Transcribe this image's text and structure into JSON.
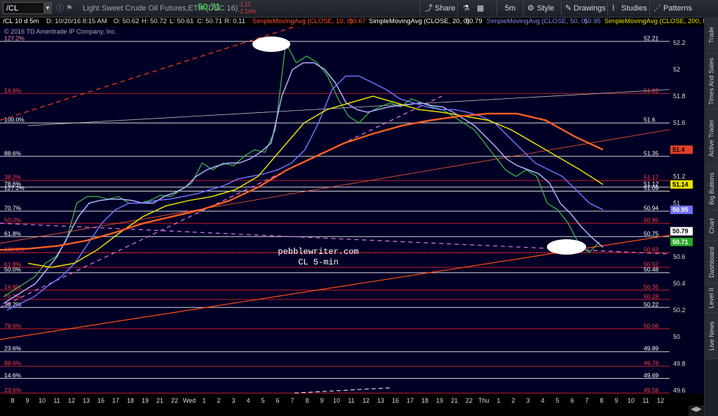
{
  "toolbar": {
    "symbol": "/CL",
    "description": "Light Sweet Crude Oil Futures,ETH (DEC 16)",
    "last_price": "50.71",
    "change": "-1.11",
    "change_pct": "-2.14%",
    "share_label": "Share",
    "timeframe": "5m",
    "style_label": "Style",
    "drawings_label": "Drawings",
    "studies_label": "Studies",
    "patterns_label": "Patterns",
    "icons": [
      "info-icon",
      "flag-icon",
      "lock-icon",
      "share-icon",
      "flask-icon",
      "grid-icon",
      "style-icon",
      "drawings-icon",
      "studies-icon",
      "patterns-icon"
    ]
  },
  "infobar": {
    "symbol": "/CL 10 d 5m",
    "date": "D: 10/20/16 8:15 AM",
    "open": "O: 50.62",
    "high": "H: 50.72",
    "low": "L: 50.61",
    "close": "C: 50.71",
    "range": "R: 0.11",
    "sma10": "SimpleMovingAvg (CLOSE, 10, 0)",
    "sma10_val": "50.67",
    "sma20": "SimpleMovingAvg (CLOSE, 20, 0)",
    "sma20_val": "50.79",
    "sma50": "SimpleMovingAvg (CLOSE, 50, 0)",
    "sma50_val": "50.95",
    "sma200": "SimpleMovingAvg (CLOSE, 200, 0)",
    "copyright": "© 2016 TD Ameritrade IP Company, Inc."
  },
  "watermark": {
    "line1": "pebblewriter.com",
    "line2": "CL 5-min"
  },
  "fib_levels": [
    {
      "pct": "127.2%",
      "price": "52.21",
      "pct_color": "#ff9a9a",
      "price_color": "#ffffff",
      "value": 52.21
    },
    {
      "pct": "14.6%",
      "price": "51.82",
      "pct_color": "#ff4040",
      "price_color": "#ff4040",
      "value": 51.82
    },
    {
      "pct": "100.0%",
      "price": "51.6",
      "pct_color": "#ffffff",
      "price_color": "#ffffff",
      "value": 51.6
    },
    {
      "pct": "88.6%",
      "price": "51.35",
      "pct_color": "#ffffff",
      "price_color": "#ffffff",
      "value": 51.35
    },
    {
      "pct": "38.2%",
      "price": "51.17",
      "pct_color": "#ff4040",
      "price_color": "#ff4040",
      "value": 51.17
    },
    {
      "pct": "78.6%",
      "price": "51.12",
      "pct_color": "#ffffff",
      "price_color": "#ffffff",
      "value": 51.12
    },
    {
      "pct": "127.2%",
      "price": "51.09",
      "pct_color": "#ffffff",
      "price_color": "#ffffff",
      "value": 51.09
    },
    {
      "pct": "70.7%",
      "price": "50.94",
      "pct_color": "#ffffff",
      "price_color": "#ffffff",
      "value": 50.94
    },
    {
      "pct": "50.0%",
      "price": "50.85",
      "pct_color": "#ff4040",
      "price_color": "#ff4040",
      "value": 50.85
    },
    {
      "pct": "61.8%",
      "price": "50.75",
      "pct_color": "#ffffff",
      "price_color": "#ffffff",
      "value": 50.75
    },
    {
      "pct": "100.0%",
      "price": "50.63",
      "pct_color": "#ff4040",
      "price_color": "#ff4040",
      "value": 50.63
    },
    {
      "pct": "61.8%",
      "price": "50.52",
      "pct_color": "#ff4040",
      "price_color": "#ff4040",
      "value": 50.52
    },
    {
      "pct": "50.0%",
      "price": "50.48",
      "pct_color": "#ffffff",
      "price_color": "#ffffff",
      "value": 50.48
    },
    {
      "pct": "14.6%",
      "price": "50.35",
      "pct_color": "#ff4040",
      "price_color": "#ff4040",
      "value": 50.35
    },
    {
      "pct": "70.7%",
      "price": "50.28",
      "pct_color": "#ff4040",
      "price_color": "#ff4040",
      "value": 50.28
    },
    {
      "pct": "38.2%",
      "price": "50.22",
      "pct_color": "#ffffff",
      "price_color": "#ffffff",
      "value": 50.22
    },
    {
      "pct": "78.6%",
      "price": "50.06",
      "pct_color": "#ff4040",
      "price_color": "#ff4040",
      "value": 50.06
    },
    {
      "pct": "23.6%",
      "price": "49.89",
      "pct_color": "#ffffff",
      "price_color": "#ffffff",
      "value": 49.89
    },
    {
      "pct": "88.6%",
      "price": "49.78",
      "pct_color": "#ff4040",
      "price_color": "#ff4040",
      "value": 49.78
    },
    {
      "pct": "14.6%",
      "price": "49.69",
      "pct_color": "#ffffff",
      "price_color": "#ffffff",
      "value": 49.69
    },
    {
      "pct": "23.6%",
      "price": "49.58",
      "pct_color": "#ff4040",
      "price_color": "#ff4040",
      "value": 49.58
    }
  ],
  "price_axis": [
    "52.2",
    "52",
    "51.8",
    "51.6",
    "51.4",
    "51.2",
    "51",
    "50.8",
    "50.6",
    "50.4",
    "50.2",
    "50",
    "49.8",
    "49.6"
  ],
  "price_tags": [
    {
      "label": "51.4",
      "bg": "#e8402a",
      "fg": "#000",
      "value": 51.4
    },
    {
      "label": "51.14",
      "bg": "#e8e000",
      "fg": "#000",
      "value": 51.14
    },
    {
      "label": "50.95",
      "bg": "#7070ff",
      "fg": "#fff",
      "value": 50.95
    },
    {
      "label": "50.79",
      "bg": "#ffffff",
      "fg": "#000",
      "value": 50.79
    },
    {
      "label": "50.71",
      "bg": "#2aaa2a",
      "fg": "#fff",
      "value": 50.71
    }
  ],
  "time_axis": [
    "8",
    "9",
    "10",
    "11",
    "12",
    "13",
    "16",
    "17",
    "18",
    "19",
    "21",
    "22",
    "Wed",
    "1",
    "2",
    "3",
    "4",
    "5",
    "6",
    "7",
    "8",
    "9",
    "10",
    "11",
    "12",
    "13",
    "16",
    "17",
    "18",
    "19",
    "21",
    "22",
    "Thu",
    "1",
    "2",
    "3",
    "4",
    "5",
    "6",
    "7",
    "8",
    "9",
    "10",
    "11",
    "12"
  ],
  "side_tabs": [
    "Trade",
    "Times And Sales",
    "Active Trader",
    "Big Buttons",
    "Chart",
    "Dashboard",
    "Level II",
    "Live News"
  ],
  "chart_data": {
    "type": "line",
    "title": "Light Sweet Crude Oil Futures,ETH (DEC 16)",
    "ylim": [
      49.55,
      52.32
    ],
    "series": [
      {
        "name": "CL 5m close",
        "color": "#3ec24a",
        "values": [
          50.3,
          50.35,
          50.4,
          50.45,
          50.55,
          50.6,
          50.72,
          51.0,
          51.05,
          51.05,
          51.03,
          51.05,
          51.0,
          51.0,
          51.02,
          51.06,
          51.05,
          51.1,
          51.15,
          51.3,
          51.25,
          51.3,
          51.28,
          51.35,
          51.4,
          51.38,
          51.55,
          52.2,
          52.05,
          52.1,
          52.05,
          51.95,
          51.78,
          51.65,
          51.6,
          51.68,
          51.72,
          51.75,
          51.72,
          51.78,
          51.75,
          51.72,
          51.7,
          51.65,
          51.6,
          51.55,
          51.45,
          51.35,
          51.25,
          51.2,
          51.25,
          51.2,
          51.0,
          50.95,
          50.85,
          50.7,
          50.63,
          50.71
        ]
      },
      {
        "name": "SMA 10",
        "color": "#b0b0ff",
        "values": [
          50.25,
          50.3,
          50.35,
          50.4,
          50.5,
          50.6,
          50.75,
          50.9,
          51.0,
          51.02,
          51.03,
          51.03,
          51.02,
          51.0,
          51.0,
          51.05,
          51.08,
          51.12,
          51.2,
          51.25,
          51.28,
          51.3,
          51.3,
          51.33,
          51.38,
          51.45,
          51.8,
          52.0,
          52.05,
          52.05,
          52.0,
          51.9,
          51.75,
          51.7,
          51.68,
          51.7,
          51.72,
          51.73,
          51.74,
          51.75,
          51.73,
          51.72,
          51.68,
          51.63,
          51.58,
          51.5,
          51.42,
          51.33,
          51.28,
          51.25,
          51.22,
          51.15,
          51.0,
          50.92,
          50.82,
          50.74,
          50.67
        ]
      },
      {
        "name": "SMA 50",
        "color": "#7070ff",
        "values": [
          50.2,
          50.25,
          50.3,
          50.38,
          50.45,
          50.55,
          50.7,
          50.85,
          50.95,
          51.0,
          51.0,
          51.02,
          51.03,
          51.05,
          51.07,
          51.1,
          51.13,
          51.18,
          51.2,
          51.22,
          51.25,
          51.3,
          51.4,
          51.6,
          51.85,
          51.95,
          51.95,
          51.9,
          51.85,
          51.78,
          51.75,
          51.72,
          51.7,
          51.7,
          51.68,
          51.65,
          51.6,
          51.5,
          51.4,
          51.3,
          51.25,
          51.2,
          51.1,
          51.0,
          50.95
        ]
      },
      {
        "name": "SMA 200",
        "color": "#e8e000",
        "values": [
          50.55,
          50.52,
          50.55,
          50.65,
          50.78,
          50.9,
          50.98,
          51.02,
          51.05,
          51.1,
          51.2,
          51.4,
          51.6,
          51.7,
          51.75,
          51.8,
          51.75,
          51.7,
          51.68,
          51.65,
          51.62,
          51.55,
          51.45,
          51.35,
          51.25,
          51.14
        ]
      },
      {
        "name": "SMA 20 (orange)",
        "color": "#ff6020",
        "values": [
          50.65,
          50.66,
          50.68,
          50.72,
          50.78,
          50.85,
          50.9,
          50.95,
          51.02,
          51.12,
          51.25,
          51.35,
          51.45,
          51.52,
          51.58,
          51.62,
          51.65,
          51.67,
          51.67,
          51.62,
          51.5,
          51.4
        ]
      }
    ]
  }
}
